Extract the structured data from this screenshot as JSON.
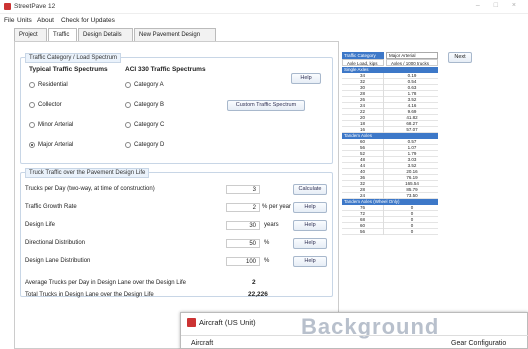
{
  "window": {
    "title": "StreetPave 12",
    "controls": "– □ ×"
  },
  "menu": [
    "File",
    "Units",
    "About",
    "Check for Updates"
  ],
  "tabs": [
    "Project",
    "Traffic",
    "Design Details",
    "New Pavement Design"
  ],
  "traffic_category": {
    "group_title": "Traffic Category / Load Spectrum",
    "col1_heading": "Typical Traffic Spectrums",
    "col2_heading": "ACI 330 Traffic Spectrums",
    "help_label": "Help",
    "typical_options": [
      "Residential",
      "Collector",
      "Minor Arterial",
      "Major Arterial"
    ],
    "aci_options": [
      "Category A",
      "Category B",
      "Category C",
      "Category D"
    ],
    "selected": "Major Arterial",
    "custom_button": "Custom Traffic Spectrum"
  },
  "truck_traffic": {
    "group_title": "Truck Traffic over the Pavement Design Life",
    "rows": [
      {
        "label": "Trucks per Day (two-way, at time of construction)",
        "value": "3",
        "unit": "",
        "button": "Calculate"
      },
      {
        "label": "Traffic Growth Rate",
        "value": "2",
        "unit": "% per year",
        "button": "Help"
      },
      {
        "label": "Design Life",
        "value": "30",
        "unit": "years",
        "button": "Help"
      },
      {
        "label": "Directional Distribution",
        "value": "50",
        "unit": "%",
        "button": "Help"
      },
      {
        "label": "Design Lane Distribution",
        "value": "100",
        "unit": "%",
        "button": "Help"
      }
    ],
    "avg_label": "Average Trucks per Day in Design Lane over the Design Life",
    "avg_value": "2",
    "total_label": "Total Trucks in Design Lane over the Design Life",
    "total_value": "22,226"
  },
  "spectrum_table": {
    "head_category_label": "Traffic Category",
    "head_category_value": "Major Arterial",
    "col_axle": "Axle Load, kips",
    "col_axles": "Axles / 1000 trucks",
    "sections": [
      {
        "title": "Single Axles",
        "rows": [
          [
            "34",
            "0.19"
          ],
          [
            "32",
            "0.54"
          ],
          [
            "30",
            "0.63"
          ],
          [
            "28",
            "1.78"
          ],
          [
            "26",
            "3.52"
          ],
          [
            "24",
            "4.16"
          ],
          [
            "22",
            "9.69"
          ],
          [
            "20",
            "41.82"
          ],
          [
            "18",
            "68.27"
          ],
          [
            "16",
            "57.07"
          ]
        ]
      },
      {
        "title": "Tandem Axles",
        "rows": [
          [
            "60",
            "0.57"
          ],
          [
            "56",
            "1.07"
          ],
          [
            "52",
            "1.79"
          ],
          [
            "48",
            "3.03"
          ],
          [
            "44",
            "3.52"
          ],
          [
            "40",
            "20.16"
          ],
          [
            "36",
            "76.19"
          ],
          [
            "32",
            "165.54"
          ],
          [
            "28",
            "85.79"
          ],
          [
            "24",
            "73.50"
          ]
        ]
      },
      {
        "title": "Tandem Axles (Wheel Only)",
        "rows": [
          [
            "76",
            "0"
          ],
          [
            "72",
            "0"
          ],
          [
            "68",
            "0"
          ],
          [
            "60",
            "0"
          ],
          [
            "56",
            "0"
          ]
        ]
      }
    ]
  },
  "next_label": "Next",
  "overlay": {
    "title": "Aircraft (US Unit)",
    "watermark": "Background",
    "col_aircraft": "Aircraft",
    "col_gear": "Gear Configuratio"
  }
}
